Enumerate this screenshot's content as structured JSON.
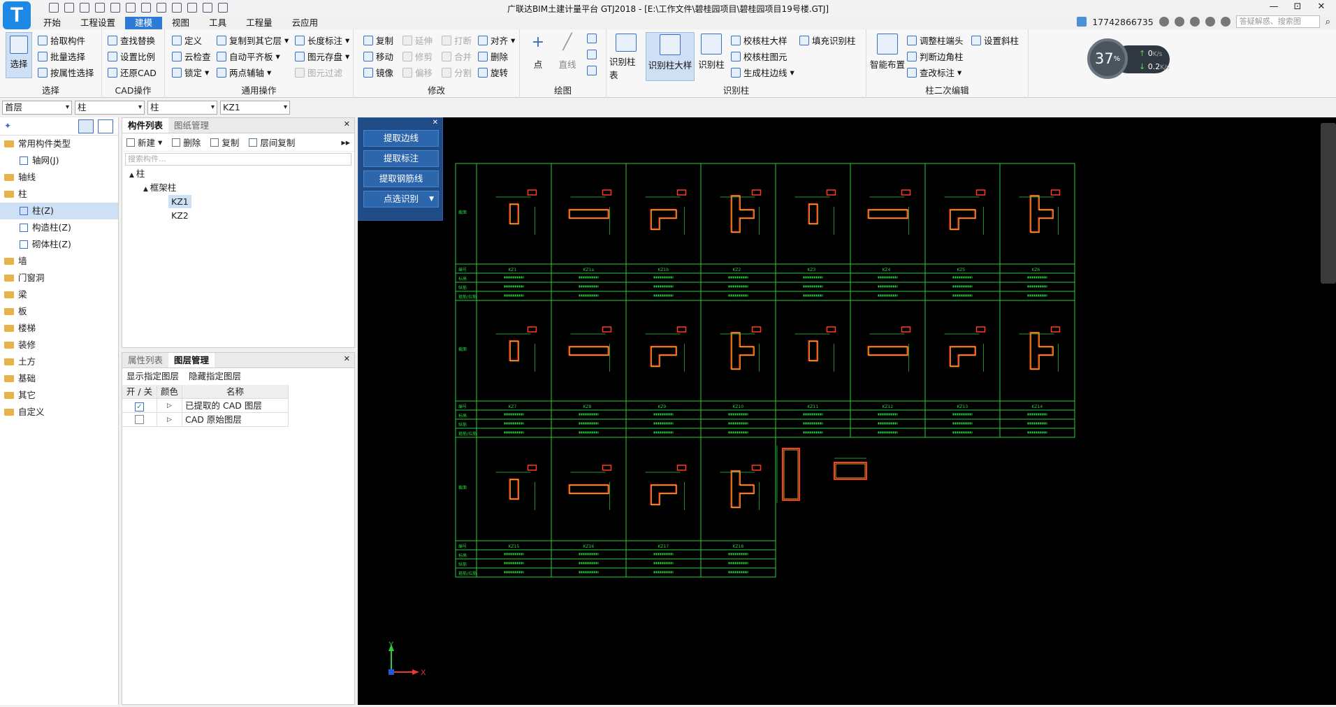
{
  "window": {
    "title": "广联达BIM土建计量平台 GTJ2018 - [E:\\工作文件\\碧桂园项目\\碧桂园项目19号楼.GTJ]",
    "logo_letter": "T",
    "controls": [
      "—",
      "⊡",
      "✕"
    ]
  },
  "menu": {
    "items": [
      "开始",
      "工程设置",
      "建模",
      "视图",
      "工具",
      "工程量",
      "云应用"
    ],
    "active": "建模"
  },
  "user": {
    "phone": "17742866735",
    "search_placeholder": "答疑解惑、搜索图"
  },
  "ribbon": {
    "select_group": {
      "label": "选择",
      "big": "选择",
      "items": [
        "拾取构件",
        "批量选择",
        "按属性选择"
      ]
    },
    "cad_group": {
      "label": "CAD操作",
      "items": [
        "查找替换",
        "设置比例",
        "还原CAD"
      ]
    },
    "common_group": {
      "label": "通用操作",
      "items": [
        "定义",
        "云检查",
        "锁定",
        "复制到其它层",
        "自动平齐板",
        "两点辅轴",
        "长度标注",
        "图元存盘",
        "图元过滤"
      ]
    },
    "modify_group": {
      "label": "修改",
      "items": [
        "复制",
        "移动",
        "镜像",
        "延伸",
        "修剪",
        "偏移",
        "打断",
        "合并",
        "分割",
        "对齐",
        "删除",
        "旋转"
      ]
    },
    "draw_group": {
      "label": "绘图",
      "items": [
        "点",
        "直线"
      ]
    },
    "identify_group": {
      "label": "识别柱",
      "big": [
        "识别柱表",
        "识别柱大样",
        "识别柱"
      ],
      "items": [
        "校核柱大样",
        "填充识别柱",
        "校核柱图元",
        "生成柱边线"
      ]
    },
    "secondary_group": {
      "label": "柱二次编辑",
      "big": "智能布置",
      "items": [
        "调整柱端头",
        "设置斜柱",
        "判断边角柱",
        "查改标注"
      ]
    }
  },
  "gauge": {
    "percent": "37",
    "unit": "%",
    "up": "0",
    "down": "0.2",
    "rate_unit": "K/s"
  },
  "selectors": [
    "首层",
    "柱",
    "柱",
    "KZ1"
  ],
  "nav": {
    "items": [
      {
        "label": "常用构件类型",
        "type": "folder"
      },
      {
        "label": "轴网(J)",
        "type": "sub"
      },
      {
        "label": "轴线",
        "type": "folder"
      },
      {
        "label": "柱",
        "type": "folder"
      },
      {
        "label": "柱(Z)",
        "type": "sub",
        "selected": true
      },
      {
        "label": "构造柱(Z)",
        "type": "sub"
      },
      {
        "label": "砌体柱(Z)",
        "type": "sub"
      },
      {
        "label": "墙",
        "type": "folder"
      },
      {
        "label": "门窗洞",
        "type": "folder"
      },
      {
        "label": "梁",
        "type": "folder"
      },
      {
        "label": "板",
        "type": "folder"
      },
      {
        "label": "楼梯",
        "type": "folder"
      },
      {
        "label": "装修",
        "type": "folder"
      },
      {
        "label": "土方",
        "type": "folder"
      },
      {
        "label": "基础",
        "type": "folder"
      },
      {
        "label": "其它",
        "type": "folder"
      },
      {
        "label": "自定义",
        "type": "folder"
      }
    ]
  },
  "component_panel": {
    "tabs": [
      "构件列表",
      "图纸管理"
    ],
    "toolbar": [
      "新建",
      "删除",
      "复制",
      "层间复制"
    ],
    "search_placeholder": "搜索构件...",
    "tree": [
      "柱",
      "框架柱",
      "KZ1",
      "KZ2"
    ]
  },
  "layer_panel": {
    "tabs": [
      "属性列表",
      "图层管理"
    ],
    "actions": [
      "显示指定图层",
      "隐藏指定图层"
    ],
    "headers": [
      "开 / 关",
      "颜色",
      "名称"
    ],
    "rows": [
      {
        "checked": true,
        "name": "已提取的 CAD 图层"
      },
      {
        "checked": false,
        "name": "CAD 原始图层"
      }
    ]
  },
  "float_panel": {
    "buttons": [
      "提取边线",
      "提取标注",
      "提取钢筋线",
      "点选识别"
    ]
  },
  "drawing": {
    "row_labels": [
      "截面",
      "编号",
      "标高",
      "纵筋",
      "箍筋/拉筋"
    ],
    "cells_row1": [
      "KZ1",
      "KZ1a",
      "KZ1b",
      "KZ2",
      "KZ3",
      "KZ4",
      "KZ5",
      "KZ6"
    ],
    "cells_row2": [
      "KZ7",
      "KZ8",
      "KZ9",
      "KZ10",
      "KZ11",
      "KZ12",
      "KZ13",
      "KZ14"
    ],
    "cells_row3": [
      "KZ15",
      "KZ16",
      "KZ17",
      "KZ18"
    ],
    "axis_x": "X",
    "axis_y": "Y"
  }
}
